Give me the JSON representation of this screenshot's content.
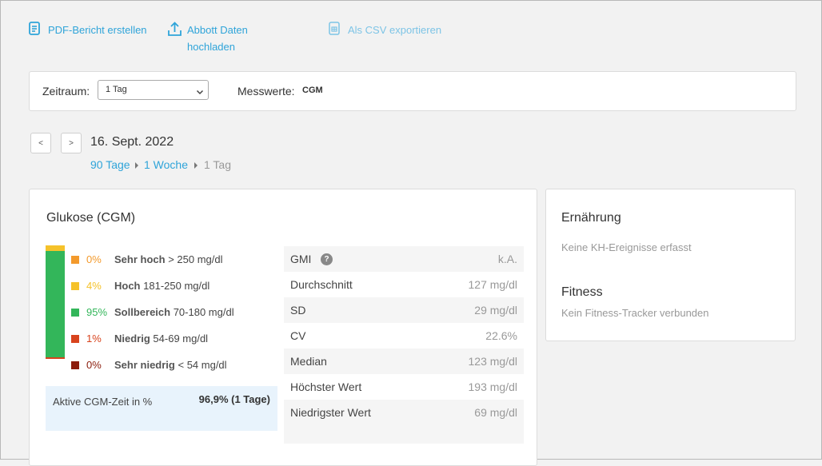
{
  "actions": {
    "pdf_report": "PDF-Bericht erstellen",
    "upload_line1": "Abbott Daten",
    "upload_line2": "hochladen",
    "csv_export": "Als CSV exportieren"
  },
  "filters": {
    "period_label": "Zeitraum:",
    "period_value": "1 Tag",
    "measurements_label": "Messwerte:",
    "measurements_value": "CGM"
  },
  "navigation": {
    "prev": "<",
    "next": ">",
    "date": "16. Sept. 2022",
    "breadcrumb": [
      "90 Tage",
      "1 Woche",
      "1 Tag"
    ]
  },
  "glucose": {
    "title": "Glukose (CGM)",
    "ranges": [
      {
        "pct": "0%",
        "name": "Sehr hoch",
        "range": "> 250 mg/dl",
        "color": "#f39a2c"
      },
      {
        "pct": "4%",
        "name": "Hoch",
        "range": "181-250 mg/dl",
        "color": "#f5c22a"
      },
      {
        "pct": "95%",
        "name": "Sollbereich",
        "range": "70-180 mg/dl",
        "color": "#33b65a"
      },
      {
        "pct": "1%",
        "name": "Niedrig",
        "range": "54-69 mg/dl",
        "color": "#d8431d"
      },
      {
        "pct": "0%",
        "name": "Sehr niedrig",
        "range": "< 54 mg/dl",
        "color": "#8b1c0c"
      }
    ],
    "active_label": "Aktive CGM-Zeit in %",
    "active_value": "96,9% (1 Tage)",
    "stats": [
      {
        "label": "GMI",
        "value": "k.A."
      },
      {
        "label": "Durchschnitt",
        "value": "127 mg/dl"
      },
      {
        "label": "SD",
        "value": "29 mg/dl"
      },
      {
        "label": "CV",
        "value": "22.6%"
      },
      {
        "label": "Median",
        "value": "123 mg/dl"
      },
      {
        "label": "Höchster Wert",
        "value": "193 mg/dl"
      },
      {
        "label": "Niedrigster Wert",
        "value": "69 mg/dl"
      }
    ]
  },
  "sidebar": {
    "nutrition_title": "Ernährung",
    "nutrition_text": "Keine KH-Ereignisse erfasst",
    "fitness_title": "Fitness",
    "fitness_text": "Kein Fitness-Tracker verbunden"
  },
  "colors": {
    "accent": "#2fa4d9",
    "target_range": "#33b65a",
    "high": "#f5c22a",
    "very_high": "#f39a2c",
    "low": "#d8431d",
    "very_low": "#8b1c0c"
  }
}
